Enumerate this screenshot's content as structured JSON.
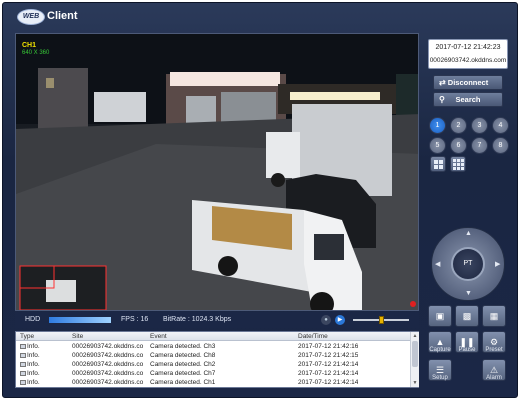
{
  "app": {
    "logo_text": "WEB",
    "title": "Client"
  },
  "video": {
    "channel_label": "CH1",
    "resolution": "640 X 360",
    "hdd_label": "HDD",
    "fps_text": "FPS : 16",
    "bitrate_text": "BitRate : 1024.3 Kbps",
    "volume_level": 0.5
  },
  "panel": {
    "datetime": "2017-07-12 21:42:23",
    "hostname": "00026903742.okddns.com",
    "disconnect_label": "Disconnect",
    "search_label": "Search",
    "channels": [
      "1",
      "2",
      "3",
      "4",
      "5",
      "6",
      "7",
      "8"
    ],
    "active_channel": "1",
    "ptz_center_label": "PT"
  },
  "actions": {
    "capture_label": "Capture",
    "pause_label": "Pause",
    "preset_label": "Preset",
    "setup_label": "Setup",
    "alarm_label": "Alarm"
  },
  "log": {
    "headers": [
      "Type",
      "Site",
      "Event",
      "Date/Time"
    ],
    "rows": [
      {
        "type": "Info.",
        "site": "00026903742.okddns.co",
        "event": "Camera detected. Ch3",
        "datetime": "2017-07-12 21:42:16"
      },
      {
        "type": "Info.",
        "site": "00026903742.okddns.co",
        "event": "Camera detected. Ch8",
        "datetime": "2017-07-12 21:42:15"
      },
      {
        "type": "Info.",
        "site": "00026903742.okddns.co",
        "event": "Camera detected. Ch2",
        "datetime": "2017-07-12 21:42:14"
      },
      {
        "type": "Info.",
        "site": "00026903742.okddns.co",
        "event": "Camera detected. Ch7",
        "datetime": "2017-07-12 21:42:14"
      },
      {
        "type": "Info.",
        "site": "00026903742.okddns.co",
        "event": "Camera detected. Ch1",
        "datetime": "2017-07-12 21:42:14"
      }
    ]
  },
  "colors": {
    "accent": "#2b78d8",
    "frame": "#1b2746",
    "channel_label": "#f0e100",
    "resolution": "#37c837"
  }
}
